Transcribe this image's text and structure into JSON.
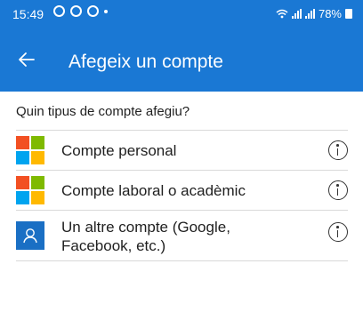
{
  "status_bar": {
    "time": "15:49",
    "battery": "78%",
    "notification_icons": [
      "whatsapp-icon",
      "sync-icon",
      "sync-icon",
      "dot-icon"
    ]
  },
  "header": {
    "title": "Afegeix un compte",
    "background": "#1a78d4"
  },
  "prompt": "Quin tipus de compte afegiu?",
  "account_types": [
    {
      "label": "Compte personal",
      "icon": "microsoft-logo-icon"
    },
    {
      "label": "Compte laboral o acadèmic",
      "icon": "microsoft-logo-icon"
    },
    {
      "label": "Un altre compte (Google, Facebook, etc.)",
      "icon": "person-icon"
    }
  ],
  "colors": {
    "ms_red": "#f25022",
    "ms_green": "#7fba00",
    "ms_blue": "#00a4ef",
    "ms_yellow": "#ffb900",
    "other_icon_bg": "#1a6fc4"
  }
}
